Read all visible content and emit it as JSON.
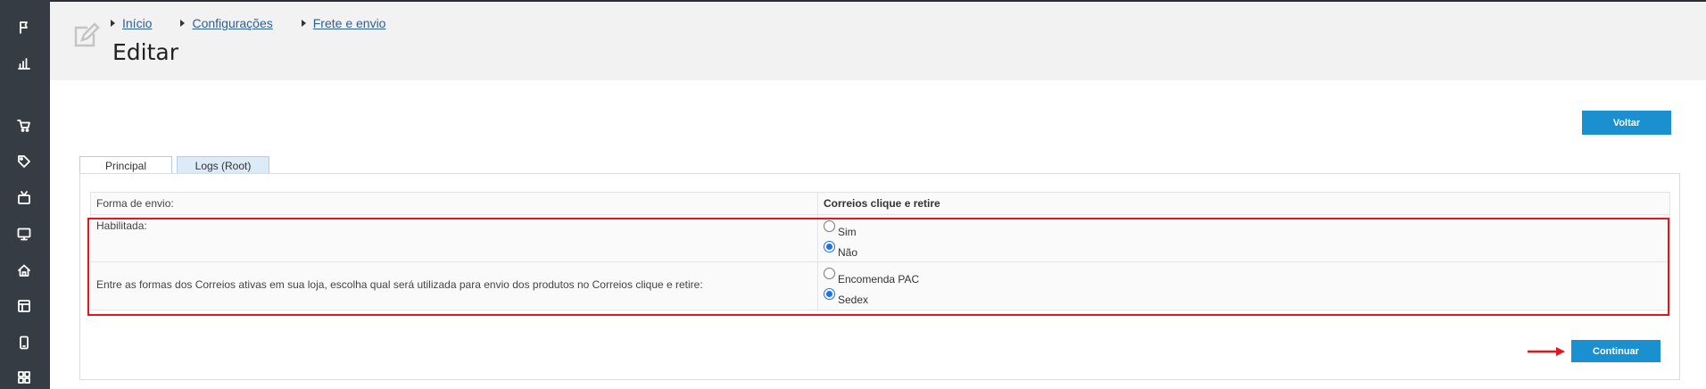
{
  "sidebar": {
    "icons": [
      "flag-icon",
      "bar-chart-icon",
      "cart-icon",
      "tag-icon",
      "tv-icon",
      "monitor-icon",
      "home-icon",
      "layout-icon",
      "phone-icon",
      "grid-icon"
    ]
  },
  "header": {
    "breadcrumb": [
      "Início",
      "Configurações",
      "Frete e envio"
    ],
    "title": "Editar"
  },
  "toolbar": {
    "back_label": "Voltar"
  },
  "tabs": [
    {
      "label": "Principal",
      "active": true
    },
    {
      "label": "Logs (Root)",
      "active": false
    }
  ],
  "form": {
    "header_row": {
      "label": "Forma de envio:",
      "value": "Correios clique e retire"
    },
    "enabled": {
      "label": "Habilitada:",
      "options": [
        {
          "label": "Sim",
          "checked": false
        },
        {
          "label": "Não",
          "checked": true
        }
      ]
    },
    "service": {
      "label": "Entre as formas dos Correios ativas em sua loja, escolha qual será utilizada para envio dos produtos no Correios clique e retire:",
      "options": [
        {
          "label": "Encomenda PAC",
          "checked": false
        },
        {
          "label": "Sedex",
          "checked": true
        }
      ]
    },
    "submit_label": "Continuar"
  },
  "colors": {
    "accent": "#1a90d0",
    "highlight": "#e8141b",
    "sidebar": "#363c44"
  }
}
